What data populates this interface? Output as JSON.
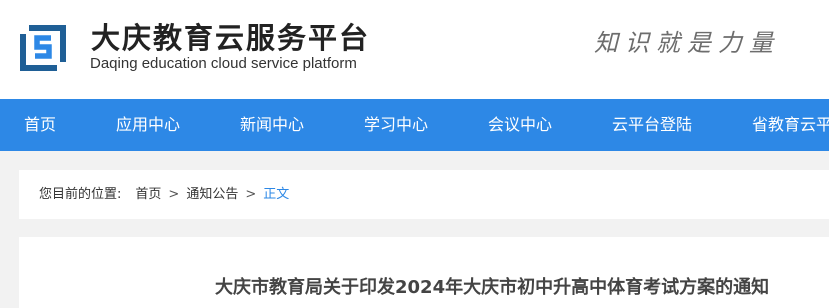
{
  "header": {
    "title": "大庆教育云服务平台",
    "subtitle": "Daqing education cloud service platform",
    "slogan": "知识就是力量",
    "logo_icon": "platform-logo-icon",
    "logo_colors": [
      "#1f5f96",
      "#2d88e6"
    ]
  },
  "nav": {
    "background": "#2d88e6",
    "items": [
      {
        "label": "首页"
      },
      {
        "label": "应用中心"
      },
      {
        "label": "新闻中心"
      },
      {
        "label": "学习中心"
      },
      {
        "label": "会议中心"
      },
      {
        "label": "云平台登陆"
      },
      {
        "label": "省教育云平"
      }
    ]
  },
  "breadcrumb": {
    "label": "您目前的位置:",
    "items": [
      "首页",
      "通知公告",
      "正文"
    ],
    "separator": ">",
    "current_color": "#2d88e6"
  },
  "article": {
    "title": "大庆市教育局关于印发2024年大庆市初中升高中体育考试方案的通知"
  }
}
